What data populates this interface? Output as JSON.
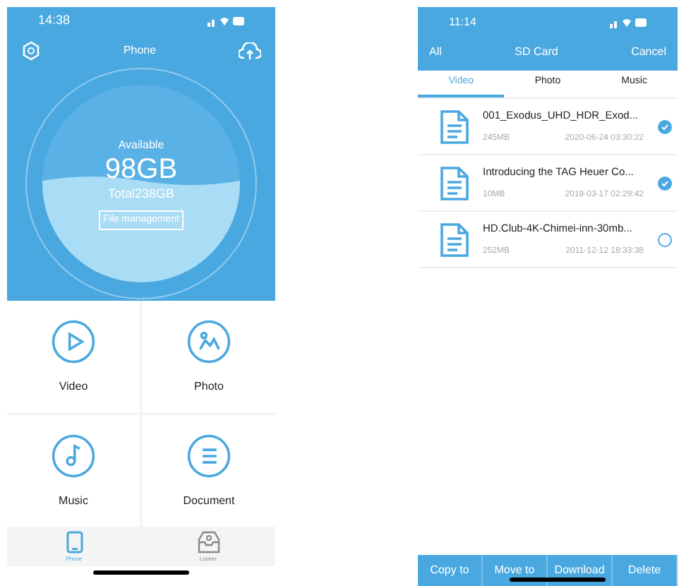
{
  "phone_screen": {
    "status_bar": {
      "time": "14:38"
    },
    "title": "Phone",
    "storage": {
      "label": "Available",
      "free": "98GB",
      "total": "Total238GB",
      "button": "File management"
    },
    "categories": [
      {
        "kind": "video",
        "label": "Video"
      },
      {
        "kind": "photo",
        "label": "Photo"
      },
      {
        "kind": "music",
        "label": "Music"
      },
      {
        "kind": "document",
        "label": "Document"
      }
    ],
    "tab_bar": [
      {
        "kind": "phone",
        "label": "Phone",
        "selected": true
      },
      {
        "kind": "locker",
        "label": "Locker",
        "selected": false
      }
    ]
  },
  "sd_card_screen": {
    "status_bar": {
      "time": "11:14"
    },
    "left_action": "All",
    "title": "SD Card",
    "right_action": "Cancel",
    "tabs": [
      {
        "label": "Video",
        "selected": true
      },
      {
        "label": "Photo",
        "selected": false
      },
      {
        "label": "Music",
        "selected": false
      }
    ],
    "files": [
      {
        "name": "001_Exodus_UHD_HDR_Exod...",
        "size": "245MB",
        "date": "2020-06-24 03:30:22",
        "checked": true
      },
      {
        "name": "Introducing the TAG Heuer Co...",
        "size": "10MB",
        "date": "2019-03-17 02:29:42",
        "checked": true
      },
      {
        "name": "HD.Club-4K-Chimei-inn-30mb...",
        "size": "252MB",
        "date": "2011-12-12 18:33:38",
        "checked": false
      }
    ],
    "actions": [
      "Copy to",
      "Move to",
      "Download",
      "Delete"
    ]
  }
}
